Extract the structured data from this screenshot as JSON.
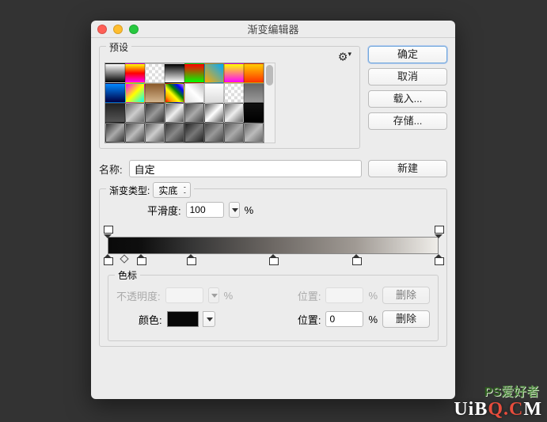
{
  "window": {
    "title": "渐变编辑器"
  },
  "presets": {
    "label": "预设"
  },
  "buttons": {
    "ok": "确定",
    "cancel": "取消",
    "load": "载入...",
    "save": "存储...",
    "new": "新建",
    "delete": "删除"
  },
  "name": {
    "label": "名称:",
    "value": "自定"
  },
  "gradientType": {
    "label": "渐变类型:",
    "value": "实底"
  },
  "smoothness": {
    "label": "平滑度:",
    "value": "100",
    "unit": "%"
  },
  "chart_data": {
    "type": "bar",
    "title": "gradient-bar",
    "opacity_stops": [
      {
        "position": 0,
        "opacity": 100
      },
      {
        "position": 100,
        "opacity": 100
      }
    ],
    "color_stops": [
      {
        "position": 0,
        "color": "#0a0a0a"
      },
      {
        "position": 10,
        "color": "#0f0f0f"
      },
      {
        "position": 25,
        "color": "#353535"
      },
      {
        "position": 50,
        "color": "#6d6864"
      },
      {
        "position": 75,
        "color": "#a09a94"
      },
      {
        "position": 100,
        "color": "#efede9"
      }
    ],
    "midpoints": [
      5
    ]
  },
  "stops": {
    "legend": "色标",
    "opacityLabel": "不透明度:",
    "positionLabel": "位置:",
    "colorLabel": "颜色:",
    "unit": "%",
    "position_value": "0"
  },
  "preset_gradients": [
    "linear-gradient(to bottom,#fff,#000)",
    "linear-gradient(to bottom,#ff0,#f00,#f0f)",
    "repeating-conic-gradient(#ddd 0 25%,#fff 0 50%) 0/8px 8px",
    "linear-gradient(#000,#fff)",
    "linear-gradient(#f00,#0f0)",
    "linear-gradient(45deg,#fa0,#0af)",
    "linear-gradient(#ff0,#f0f)",
    "linear-gradient(#ffcc00,#ff3300)",
    "linear-gradient(#08f,#004)",
    "linear-gradient(135deg,#f0f,#ff0,#0ff)",
    "linear-gradient(#8b5a2b,#d2b48c)",
    "linear-gradient(45deg,red,orange,yellow,green,blue,violet)",
    "linear-gradient(45deg,#e0e0e0,#fff,#c0c0c0)",
    "linear-gradient(#fff,#ddd)",
    "repeating-conic-gradient(#ddd 0 25%,#fff 0 50%) 0/8px 8px",
    "linear-gradient(#666,#999)",
    "linear-gradient(#222,#555)",
    "linear-gradient(135deg,#666,#ccc,#666)",
    "linear-gradient(135deg,#333,#999,#333)",
    "linear-gradient(135deg,#555,#eee,#555)",
    "linear-gradient(135deg,#444,#aaa,#444)",
    "linear-gradient(135deg,#555,#fff,#555)",
    "linear-gradient(135deg,#666,#eee,#666)",
    "linear-gradient(#111,#000)",
    "linear-gradient(135deg,#333,#aaa,#333)",
    "linear-gradient(135deg,#444,#bbb,#444)",
    "linear-gradient(135deg,#555,#ccc,#555)",
    "linear-gradient(135deg,#333,#888,#333)",
    "linear-gradient(135deg,#222,#777,#222)",
    "linear-gradient(135deg,#444,#999,#444)",
    "linear-gradient(135deg,#555,#aaa,#555)",
    "linear-gradient(135deg,#666,#bbb,#666)"
  ],
  "watermark": {
    "ps": "PS",
    "pshz": "爱好者",
    "line1": "UiB",
    "line2": "Q.C",
    "line3": "M"
  }
}
